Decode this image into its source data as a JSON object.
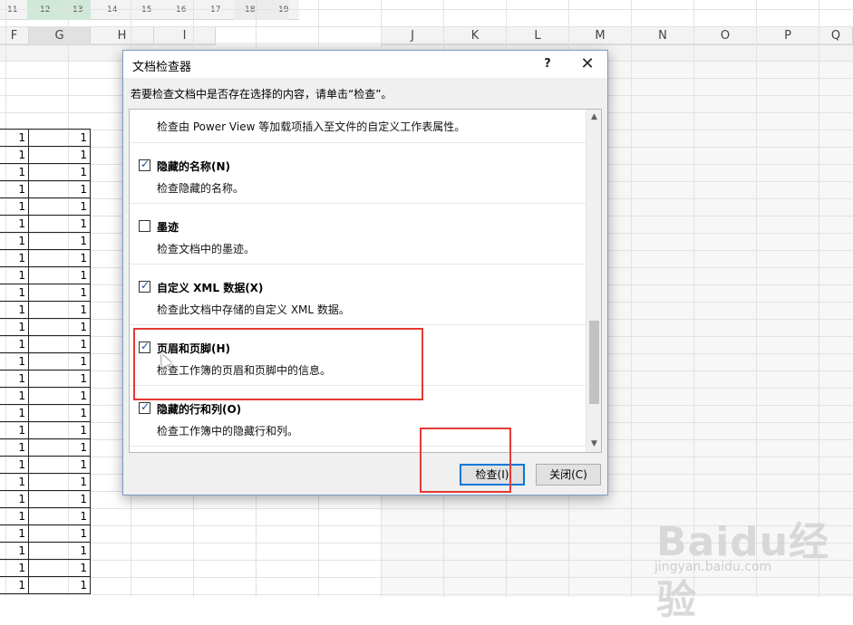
{
  "ruler": {
    "ticks": [
      "11",
      "12",
      "13",
      "14",
      "15",
      "16",
      "17",
      "18",
      "19"
    ]
  },
  "columns": [
    "F",
    "G",
    "H",
    "I",
    "J",
    "K",
    "L",
    "M",
    "N",
    "O",
    "P",
    "Q"
  ],
  "cell_value": "1",
  "dialog": {
    "title": "文档检查器",
    "help_label": "?",
    "close_label": "✕",
    "instruction": "若要检查文档中是否存在选择的内容，请单击“检查”。",
    "items": [
      {
        "name": "",
        "checked": null,
        "desc": "检查由 Power View 等加载项插入至文件的自定义工作表属性。"
      },
      {
        "name": "隐藏的名称(N)",
        "checked": true,
        "desc": "检查隐藏的名称。"
      },
      {
        "name": "墨迹",
        "checked": false,
        "desc": "检查文档中的墨迹。"
      },
      {
        "name": "自定义 XML 数据(X)",
        "checked": true,
        "desc": "检查此文档中存储的自定义 XML 数据。"
      },
      {
        "name": "页眉和页脚(H)",
        "checked": true,
        "desc": "检查工作簿的页眉和页脚中的信息。"
      },
      {
        "name": "隐藏的行和列(O)",
        "checked": true,
        "desc": "检查工作簿中的隐藏行和列。"
      }
    ],
    "scroll_up_icon": "▲",
    "scroll_down_icon": "▼",
    "inspect_button": "检查(I)",
    "close_button": "关闭(C)"
  },
  "watermark": {
    "brand": "Baidu经验",
    "url": "jingyan.baidu.com"
  }
}
